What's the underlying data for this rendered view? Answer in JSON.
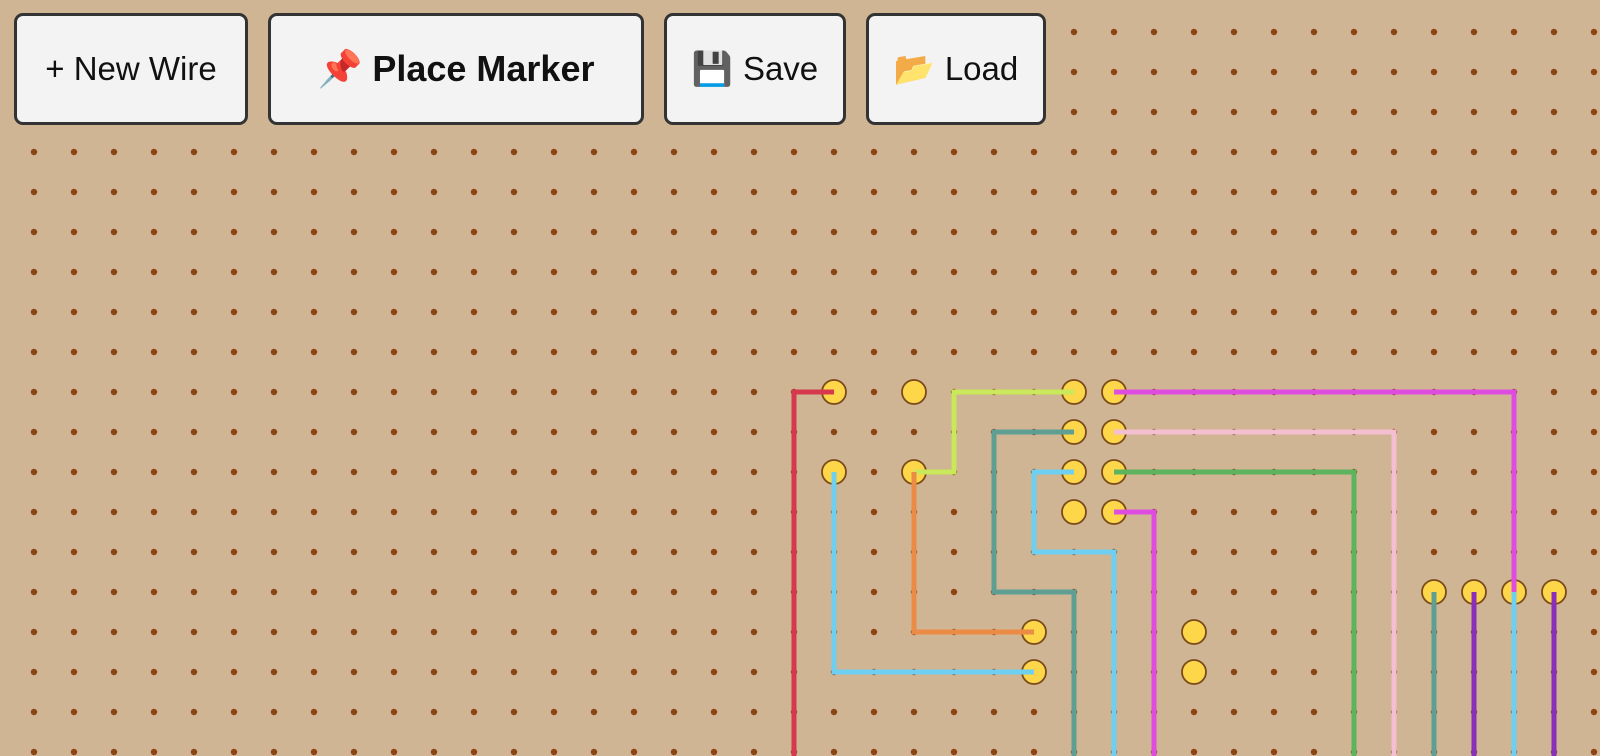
{
  "toolbar": {
    "new_wire_label": "+ New Wire",
    "place_marker_label": "Place Marker",
    "place_marker_icon": "pushpin-icon",
    "save_label": "Save",
    "save_icon": "floppy-disk-icon",
    "load_label": "Load",
    "load_icon": "open-folder-icon"
  },
  "board": {
    "background": "#cfb593",
    "hole_color": "#8b4513",
    "marker_color": "#fdd64a",
    "marker_outline": "#7a4a1a",
    "markers": [
      [
        20,
        9
      ],
      [
        22,
        9
      ],
      [
        26,
        9
      ],
      [
        27,
        9
      ],
      [
        26,
        10
      ],
      [
        27,
        10
      ],
      [
        20,
        11
      ],
      [
        22,
        11
      ],
      [
        26,
        11
      ],
      [
        27,
        11
      ],
      [
        26,
        12
      ],
      [
        27,
        12
      ],
      [
        35,
        14
      ],
      [
        36,
        14
      ],
      [
        37,
        14
      ],
      [
        38,
        14
      ],
      [
        25,
        15
      ],
      [
        29,
        15
      ],
      [
        25,
        16
      ],
      [
        29,
        16
      ]
    ],
    "wires": [
      {
        "color": "#d6394d",
        "path": [
          [
            20,
            9
          ],
          [
            19,
            9
          ],
          [
            19,
            19
          ]
        ]
      },
      {
        "color": "#c9e85a",
        "path": [
          [
            22,
            11
          ],
          [
            23,
            11
          ],
          [
            23,
            9
          ],
          [
            26,
            9
          ]
        ]
      },
      {
        "color": "#de4ddf",
        "path": [
          [
            27,
            9
          ],
          [
            37,
            9
          ],
          [
            37,
            14
          ]
        ]
      },
      {
        "color": "#5f9e92",
        "path": [
          [
            26,
            10
          ],
          [
            24,
            10
          ],
          [
            24,
            14
          ],
          [
            26,
            14
          ],
          [
            26,
            19
          ]
        ]
      },
      {
        "color": "#f4bfd0",
        "path": [
          [
            27,
            10
          ],
          [
            34,
            10
          ],
          [
            34,
            19
          ]
        ]
      },
      {
        "color": "#6ecff0",
        "path": [
          [
            26,
            11
          ],
          [
            25,
            11
          ],
          [
            25,
            13
          ],
          [
            27,
            13
          ],
          [
            27,
            19
          ]
        ]
      },
      {
        "color": "#5eb45e",
        "path": [
          [
            27,
            11
          ],
          [
            33,
            11
          ],
          [
            33,
            19
          ]
        ]
      },
      {
        "color": "#6ecff0",
        "path": [
          [
            20,
            11
          ],
          [
            20,
            16
          ],
          [
            25,
            16
          ]
        ]
      },
      {
        "color": "#ec8b46",
        "path": [
          [
            22,
            11
          ],
          [
            22,
            15
          ],
          [
            25,
            15
          ]
        ]
      },
      {
        "color": "#de4ddf",
        "path": [
          [
            27,
            12
          ],
          [
            28,
            12
          ],
          [
            28,
            19
          ]
        ]
      },
      {
        "color": "#5f9e92",
        "path": [
          [
            35,
            14
          ],
          [
            35,
            19
          ]
        ]
      },
      {
        "color": "#8a2fb8",
        "path": [
          [
            36,
            14
          ],
          [
            36,
            19
          ]
        ]
      },
      {
        "color": "#6ecff0",
        "path": [
          [
            37,
            14
          ],
          [
            37,
            19
          ]
        ]
      },
      {
        "color": "#8a2fb8",
        "path": [
          [
            38,
            14
          ],
          [
            38,
            19
          ]
        ]
      }
    ]
  }
}
